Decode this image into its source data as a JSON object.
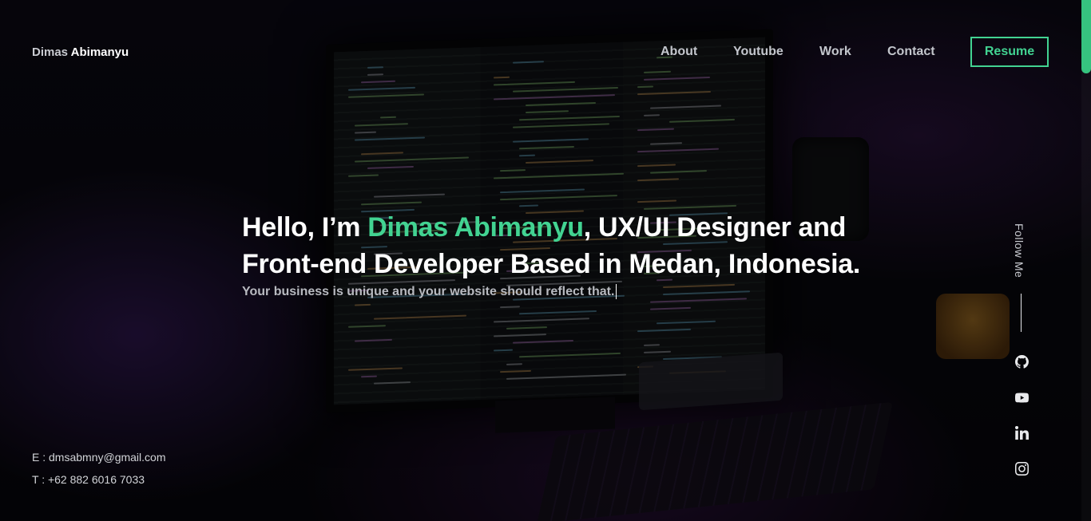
{
  "header": {
    "brand_first": "Dimas",
    "brand_last": "Abimanyu",
    "nav": [
      "About",
      "Youtube",
      "Work",
      "Contact"
    ],
    "resume_label": "Resume"
  },
  "hero": {
    "headline_pre": "Hello, I’m ",
    "headline_name": "Dimas Abimanyu",
    "headline_post": ", UX/UI Designer and Front-end Developer Based in Medan, Indonesia.",
    "tagline": "Your business is unique and your website should reflect that."
  },
  "contact": {
    "email": "E : dmsabmny@gmail.com",
    "phone": "T : +62 882 6016 7033"
  },
  "follow": {
    "label": "Follow Me",
    "icons": [
      "github-icon",
      "youtube-icon",
      "linkedin-icon",
      "instagram-icon"
    ]
  },
  "colors": {
    "accent": "#42d392",
    "background": "#07080a",
    "nav_text": "#c3c6cc"
  }
}
